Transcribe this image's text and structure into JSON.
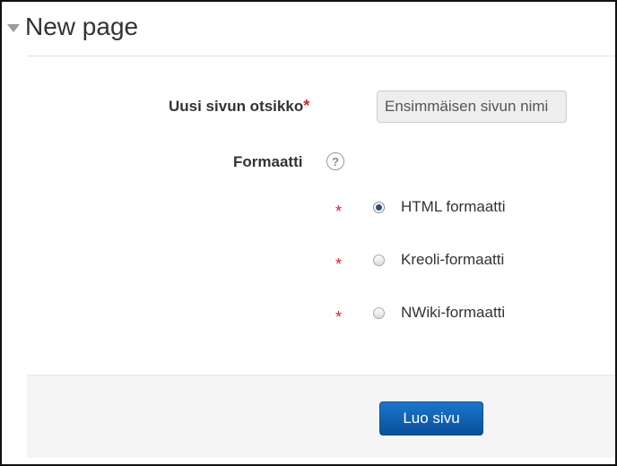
{
  "form": {
    "title": "New page",
    "page_title_field": {
      "label": "Uusi sivun otsikko",
      "required_mark": "*",
      "value": "Ensimmäisen sivun nimi"
    },
    "format_field": {
      "label": "Formaatti",
      "help_icon_glyph": "?",
      "options": [
        {
          "label": "HTML formaatti",
          "required_mark": "*",
          "checked": true
        },
        {
          "label": "Kreoli-formaatti",
          "required_mark": "*",
          "checked": false
        },
        {
          "label": "NWiki-formaatti",
          "required_mark": "*",
          "checked": false
        }
      ]
    },
    "submit_label": "Luo sivu"
  },
  "colors": {
    "required": "#d9232d",
    "primary_button": "#0a5bab",
    "action_bar_bg": "#f5f5f5"
  },
  "icons": [
    "collapse-arrow-icon",
    "help-icon",
    "radio-button-icon"
  ]
}
